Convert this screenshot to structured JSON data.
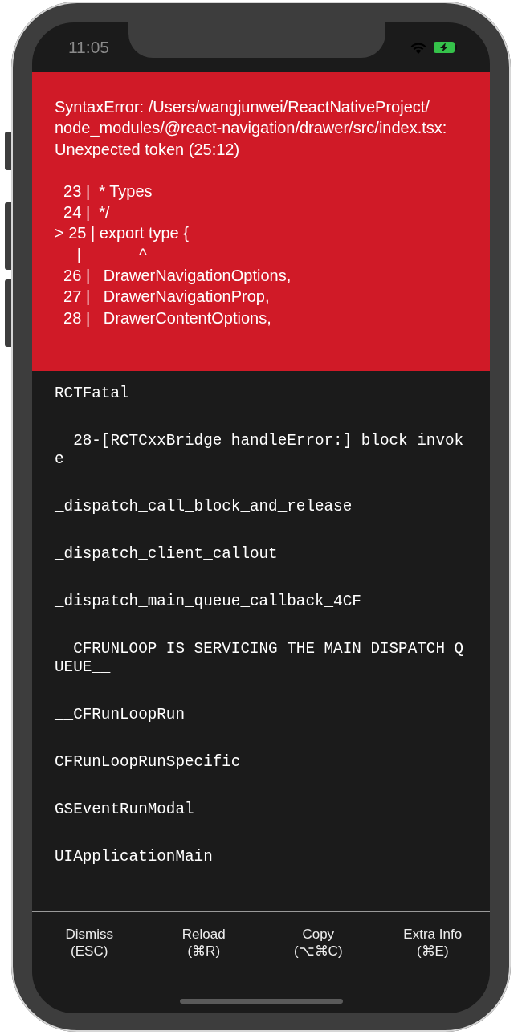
{
  "status_bar": {
    "time": "11:05"
  },
  "error": {
    "message": "SyntaxError: /Users/wangjunwei/ReactNativeProject/node_modules/@react-navigation/drawer/src/index.tsx: Unexpected token (25:12)",
    "code_frame": [
      "  23 |  * Types",
      "  24 |  */",
      "> 25 | export type {",
      "     |             ^",
      "  26 |   DrawerNavigationOptions,",
      "  27 |   DrawerNavigationProp,",
      "  28 |   DrawerContentOptions,"
    ]
  },
  "stack": [
    "RCTFatal",
    "__28-[RCTCxxBridge handleError:]_block_invoke",
    "_dispatch_call_block_and_release",
    "_dispatch_client_callout",
    "_dispatch_main_queue_callback_4CF",
    "__CFRUNLOOP_IS_SERVICING_THE_MAIN_DISPATCH_QUEUE__",
    "__CFRunLoopRun",
    "CFRunLoopRunSpecific",
    "GSEventRunModal",
    "UIApplicationMain"
  ],
  "buttons": [
    {
      "label": "Dismiss",
      "shortcut": "(ESC)"
    },
    {
      "label": "Reload",
      "shortcut": "(⌘R)"
    },
    {
      "label": "Copy",
      "shortcut": "(⌥⌘C)"
    },
    {
      "label": "Extra Info",
      "shortcut": "(⌘E)"
    }
  ]
}
